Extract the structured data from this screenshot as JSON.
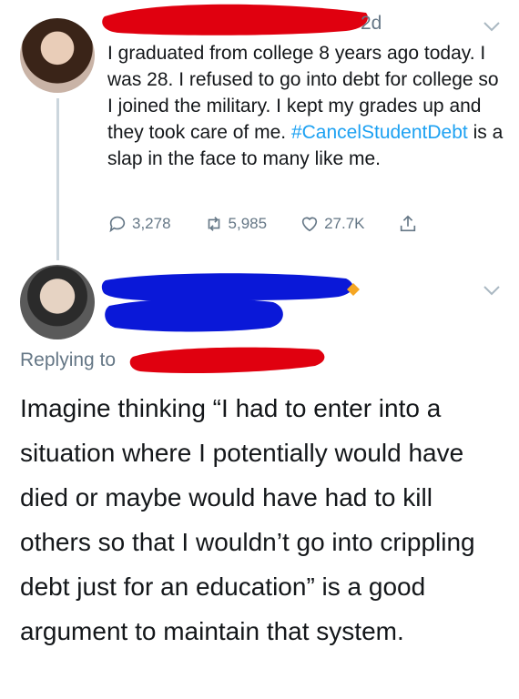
{
  "tweet": {
    "time": "2d",
    "text_before": "I graduated from college 8 years ago today. I was 28. I refused to go into debt for college so I joined the military. I kept my grades up and they took care of me. ",
    "hashtag": "#CancelStudentDebt",
    "text_after": " is a slap in the face to many like me.",
    "actions": {
      "replies": "3,278",
      "retweets": "5,985",
      "likes": "27.7K"
    }
  },
  "reply": {
    "replying_to_label": "Replying to",
    "text": "Imagine thinking “I had to enter into a situation where I potentially would have died or maybe would have had to kill others so that I wouldn’t go into crippling debt just for an education” is a good argument to maintain that system."
  },
  "icons": {
    "reply": "comment-icon",
    "retweet": "retweet-icon",
    "like": "heart-icon",
    "share": "share-icon",
    "menu": "chevron-down-icon",
    "verified": "orange-badge-icon"
  },
  "colors": {
    "redaction_red": "#e0000f",
    "redaction_blue": "#0a18d8",
    "hashtag": "#1da1f2",
    "muted": "#657786"
  }
}
